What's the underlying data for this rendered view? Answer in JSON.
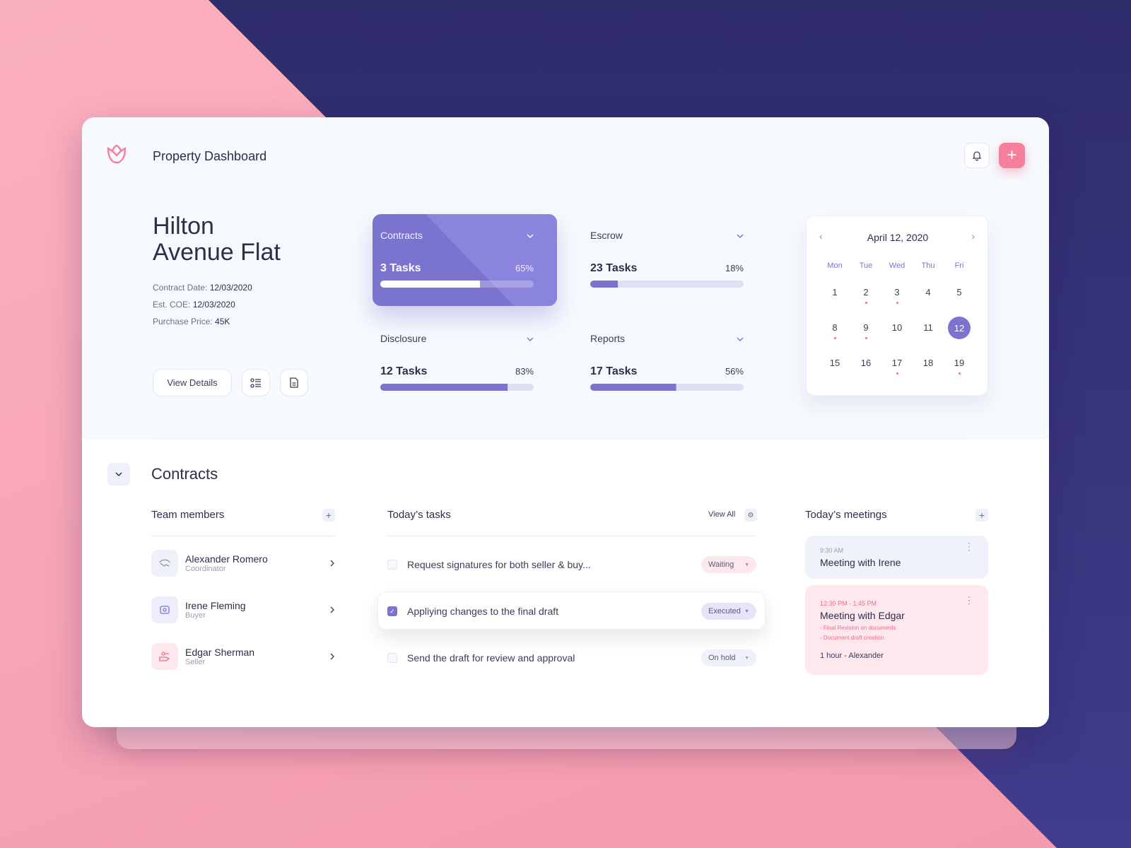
{
  "header": {
    "title": "Property Dashboard",
    "logo_icon": "tulip-icon",
    "bell_icon": "bell-icon",
    "add_icon": "plus-icon"
  },
  "property": {
    "name_line1": "Hilton",
    "name_line2": "Avenue Flat",
    "details": [
      {
        "label": "Contract Date:",
        "value": "12/03/2020"
      },
      {
        "label": "Est. COE:",
        "value": "12/03/2020"
      },
      {
        "label": "Purchase Price:",
        "value": "45K"
      }
    ],
    "view_details": "View Details"
  },
  "categories": [
    {
      "label": "Contracts",
      "tasks": "3 Tasks",
      "percent": "65%",
      "progress": 65,
      "active": true
    },
    {
      "label": "Escrow",
      "tasks": "23 Tasks",
      "percent": "18%",
      "progress": 18
    },
    {
      "label": "Disclosure",
      "tasks": "12 Tasks",
      "percent": "83%",
      "progress": 83
    },
    {
      "label": "Reports",
      "tasks": "17 Tasks",
      "percent": "56%",
      "progress": 56
    }
  ],
  "calendar": {
    "title": "April 12, 2020",
    "weekdays": [
      "Mon",
      "Tue",
      "Wed",
      "Thu",
      "Fri"
    ],
    "weeks": [
      [
        {
          "d": "1"
        },
        {
          "d": "2",
          "dot": true
        },
        {
          "d": "3",
          "dot": true
        },
        {
          "d": "4"
        },
        {
          "d": "5"
        }
      ],
      [
        {
          "d": "8",
          "dot": true
        },
        {
          "d": "9",
          "dot": true
        },
        {
          "d": "10"
        },
        {
          "d": "11"
        },
        {
          "d": "12",
          "selected": true
        }
      ],
      [
        {
          "d": "15"
        },
        {
          "d": "16"
        },
        {
          "d": "17",
          "dot": true
        },
        {
          "d": "18"
        },
        {
          "d": "19",
          "dot": true
        }
      ]
    ]
  },
  "section": {
    "title": "Contracts"
  },
  "team": {
    "title": "Team members",
    "members": [
      {
        "name": "Alexander Romero",
        "role": "Coordinator",
        "icon": "handshake-icon",
        "bg": "#eef1f7",
        "color": "#8a8ea3"
      },
      {
        "name": "Irene Fleming",
        "role": "Buyer",
        "icon": "wallet-icon",
        "bg": "#eeedfb",
        "color": "#7b74cf"
      },
      {
        "name": "Edgar Sherman",
        "role": "Seller",
        "icon": "key-hand-icon",
        "bg": "#fde8ee",
        "color": "#f06b8f"
      }
    ]
  },
  "tasks": {
    "title": "Today’s tasks",
    "view_all": "View All",
    "items": [
      {
        "text": "Request signatures for both seller & buy...",
        "status": "Waiting",
        "checked": false,
        "bg": "#fde8ee",
        "arrow": "#f06b8f"
      },
      {
        "text": "Appliying changes to the final draft",
        "status": "Executed",
        "checked": true,
        "bg": "#e6e4f8",
        "arrow": "#7b74cf"
      },
      {
        "text": "Send the draft for review and approval",
        "status": "On hold",
        "checked": false,
        "bg": "#eef1f7",
        "arrow": "#9a9db0"
      }
    ]
  },
  "meetings": {
    "title": "Today’s meetings",
    "items": [
      {
        "time": "9:30 AM",
        "title": "Meeting with Irene"
      },
      {
        "time": "12:30 PM - 1:45 PM",
        "title": "Meeting with Edgar",
        "notes": [
          "- Final Revision on documents",
          "- Document draft creation"
        ],
        "footer": "1 hour -  Alexander"
      }
    ]
  },
  "colors": {
    "accent": "#7b74cf",
    "pink": "#f77f9c",
    "navy": "#2f2c6c"
  }
}
